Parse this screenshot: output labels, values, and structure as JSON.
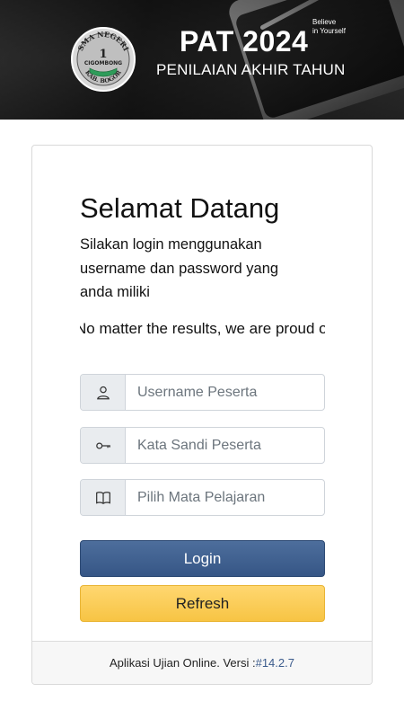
{
  "header": {
    "title": "PAT 2024",
    "subtitle": "PENILAIAN AKHIR TAHUN",
    "tagline_line1": "Believe",
    "tagline_line2": "in Yourself",
    "logo": {
      "top_text": "SMA NEGERI",
      "number": "1",
      "name": "CIGOMBONG",
      "bottom_text": "KAB. BOGOR"
    }
  },
  "login": {
    "welcome": "Selamat Datang",
    "intro": "Silakan login menggunakan username dan password yang anda miliki",
    "marquee": "No matter the results, we are proud of",
    "username_placeholder": "Username Peserta",
    "password_placeholder": "Kata Sandi Peserta",
    "subject_placeholder": "Pilih Mata Pelajaran",
    "login_label": "Login",
    "refresh_label": "Refresh"
  },
  "footer": {
    "text": "Aplikasi Ujian Online. Versi :",
    "version": "#14.2.7"
  },
  "colors": {
    "primary": "#3d5d8c",
    "warning": "#fccb55",
    "addon_bg": "#e9ecef"
  },
  "icons": [
    "user-icon",
    "key-icon",
    "book-icon"
  ]
}
